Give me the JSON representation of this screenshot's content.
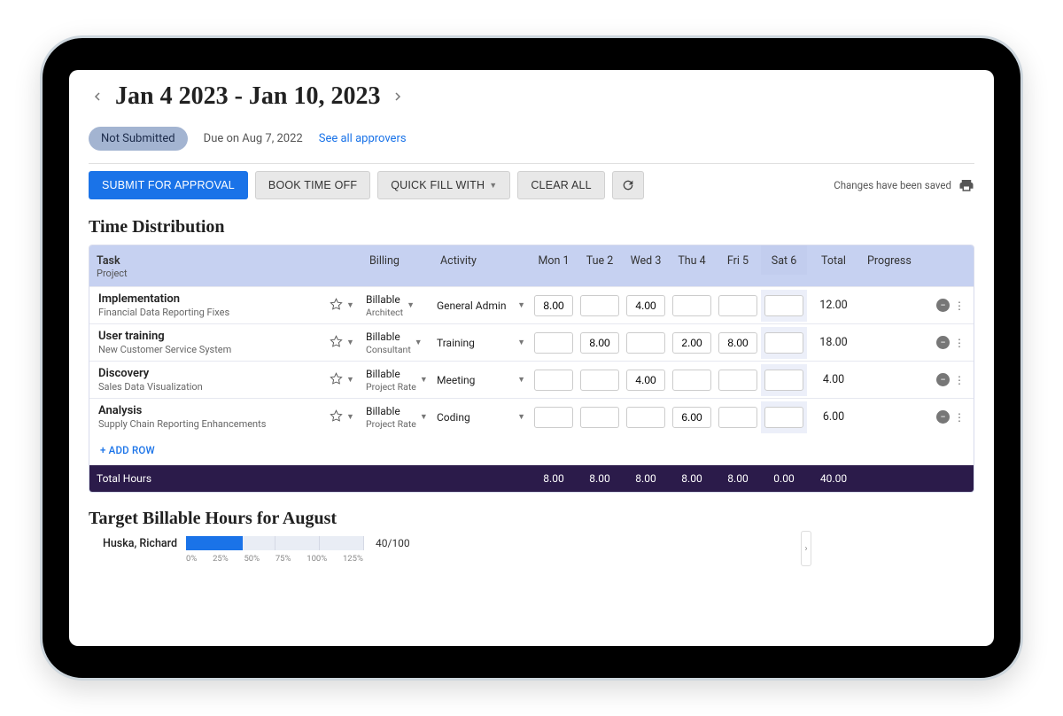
{
  "header": {
    "date_range": "Jan 4 2023 - Jan 10, 2023"
  },
  "status": {
    "pill": "Not Submitted",
    "due": "Due on Aug 7, 2022",
    "approvers_link": "See all approvers"
  },
  "toolbar": {
    "submit": "SUBMIT FOR APPROVAL",
    "book": "BOOK TIME OFF",
    "quick": "QUICK FILL WITH",
    "clear": "CLEAR ALL",
    "saved": "Changes have been saved"
  },
  "section_titles": {
    "dist": "Time Distribution",
    "target": "Target Billable Hours for August"
  },
  "columns": {
    "task": "Task",
    "task_sub": "Project",
    "billing": "Billing",
    "activity": "Activity",
    "days": [
      "Mon 1",
      "Tue 2",
      "Wed 3",
      "Thu 4",
      "Fri 5",
      "Sat 6"
    ],
    "total": "Total",
    "progress": "Progress"
  },
  "rows": [
    {
      "task": "Implementation",
      "project": "Financial Data Reporting Fixes",
      "billing": "Billable",
      "role": "Architect",
      "activity": "General Admin",
      "days": [
        "8.00",
        "",
        "4.00",
        "",
        "",
        ""
      ],
      "total": "12.00"
    },
    {
      "task": "User training",
      "project": "New Customer Service System",
      "billing": "Billable",
      "role": "Consultant",
      "activity": "Training",
      "days": [
        "",
        "8.00",
        "",
        "2.00",
        "8.00",
        ""
      ],
      "total": "18.00"
    },
    {
      "task": "Discovery",
      "project": "Sales Data Visualization",
      "billing": "Billable",
      "role": "Project Rate",
      "activity": "Meeting",
      "days": [
        "",
        "",
        "4.00",
        "",
        "",
        ""
      ],
      "total": "4.00"
    },
    {
      "task": "Analysis",
      "project": "Supply Chain Reporting Enhancements",
      "billing": "Billable",
      "role": "Project Rate",
      "activity": "Coding",
      "days": [
        "",
        "",
        "",
        "6.00",
        "",
        ""
      ],
      "total": "6.00"
    }
  ],
  "add_row": "+ ADD ROW",
  "totals": {
    "label": "Total Hours",
    "days": [
      "8.00",
      "8.00",
      "8.00",
      "8.00",
      "8.00",
      "0.00"
    ],
    "grand": "40.00"
  },
  "chart_data": {
    "type": "bar",
    "categories": [
      "Huska, Richard"
    ],
    "values": [
      40
    ],
    "max": 100,
    "value_label": "40/100",
    "ticks": [
      "0%",
      "25%",
      "50%",
      "75%",
      "100%",
      "125%"
    ],
    "xlabel": "",
    "ylabel": "",
    "title": "Target Billable Hours for August"
  }
}
